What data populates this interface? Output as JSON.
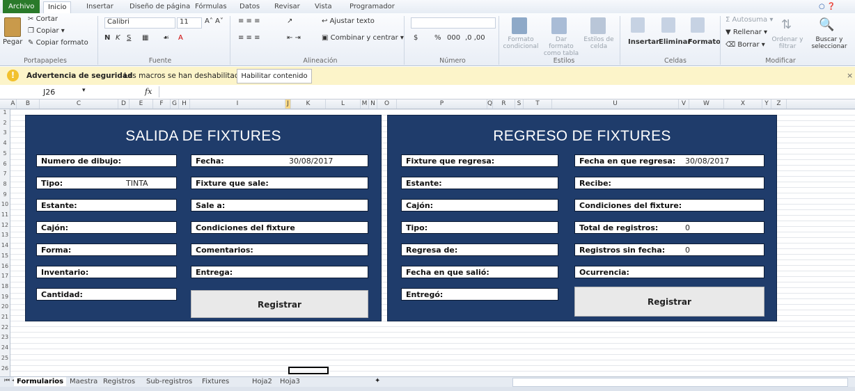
{
  "ribbon_tabs": [
    "Archivo",
    "Inicio",
    "Insertar",
    "Diseño de página",
    "Fórmulas",
    "Datos",
    "Revisar",
    "Vista",
    "Programador"
  ],
  "ribbon": {
    "clipboard": {
      "paste": "Pegar",
      "cut": "Cortar",
      "copy": "Copiar",
      "copy_format": "Copiar formato",
      "label": "Portapapeles"
    },
    "font": {
      "name": "Calibri",
      "size": "11",
      "label": "Fuente"
    },
    "alignment": {
      "wrap": "Ajustar texto",
      "merge": "Combinar y centrar",
      "label": "Alineación"
    },
    "number": {
      "label": "Número",
      "currency": "$",
      "percent": "%",
      "thousands": "000"
    },
    "styles": {
      "cond": "Formato condicional",
      "table": "Dar formato como tabla",
      "cell": "Estilos de celda",
      "label": "Estilos"
    },
    "cells": {
      "insert": "Insertar",
      "delete": "Eliminar",
      "format": "Formato",
      "label": "Celdas"
    },
    "editing": {
      "autosum": "Autosuma",
      "fill": "Rellenar",
      "clear": "Borrar",
      "sort": "Ordenar y filtrar",
      "find": "Buscar y seleccionar",
      "label": "Modificar"
    }
  },
  "security": {
    "title": "Advertencia de seguridad",
    "message": "Las macros se han deshabilitado.",
    "button": "Habilitar contenido"
  },
  "formula_bar": {
    "cell": "J26",
    "fx": "fx"
  },
  "columns": [
    "A",
    "B",
    "C",
    "D",
    "E",
    "F",
    "G",
    "H",
    "I",
    "J",
    "K",
    "L",
    "M",
    "N",
    "O",
    "P",
    "Q",
    "R",
    "S",
    "T",
    "U",
    "V",
    "W",
    "X",
    "Y",
    "Z"
  ],
  "rows": [
    "1",
    "2",
    "3",
    "4",
    "5",
    "6",
    "7",
    "8",
    "9",
    "10",
    "11",
    "12",
    "13",
    "14",
    "15",
    "16",
    "17",
    "18",
    "19",
    "20",
    "21",
    "22",
    "23",
    "24",
    "25",
    "26"
  ],
  "salida": {
    "title": "SALIDA DE FIXTURES",
    "left": [
      {
        "label": "Numero de dibujo:",
        "value": ""
      },
      {
        "label": "Tipo:",
        "value": "TINTA"
      },
      {
        "label": "Estante:",
        "value": ""
      },
      {
        "label": "Cajón:",
        "value": ""
      },
      {
        "label": "Forma:",
        "value": ""
      },
      {
        "label": "Inventario:",
        "value": ""
      },
      {
        "label": "Cantidad:",
        "value": ""
      }
    ],
    "right": [
      {
        "label": "Fecha:",
        "value": "30/08/2017"
      },
      {
        "label": "Fixture que sale:",
        "value": ""
      },
      {
        "label": "Sale a:",
        "value": ""
      },
      {
        "label": "Condiciones del fixture",
        "value": ""
      },
      {
        "label": "Comentarios:",
        "value": ""
      },
      {
        "label": "Entrega:",
        "value": ""
      }
    ],
    "button": "Registrar"
  },
  "regreso": {
    "title": "REGRESO DE FIXTURES",
    "left": [
      {
        "label": "Fixture que regresa:",
        "value": ""
      },
      {
        "label": "Estante:",
        "value": ""
      },
      {
        "label": "Cajón:",
        "value": ""
      },
      {
        "label": "Tipo:",
        "value": ""
      },
      {
        "label": "Regresa de:",
        "value": ""
      },
      {
        "label": "Fecha en que salió:",
        "value": ""
      },
      {
        "label": "Entregó:",
        "value": ""
      }
    ],
    "right": [
      {
        "label": "Fecha en que regresa:",
        "value": "30/08/2017"
      },
      {
        "label": "Recibe:",
        "value": ""
      },
      {
        "label": "Condiciones del fixture:",
        "value": ""
      },
      {
        "label": "Total de registros:",
        "value": "0"
      },
      {
        "label": "Registros sin fecha:",
        "value": "0"
      },
      {
        "label": "Ocurrencia:",
        "value": ""
      }
    ],
    "button": "Registrar"
  },
  "sheet_tabs": [
    "Formularios",
    "Maestra",
    "Registros",
    "Sub-registros",
    "Fixtures",
    "Hoja2",
    "Hoja3"
  ],
  "active_sheet": "Formularios"
}
